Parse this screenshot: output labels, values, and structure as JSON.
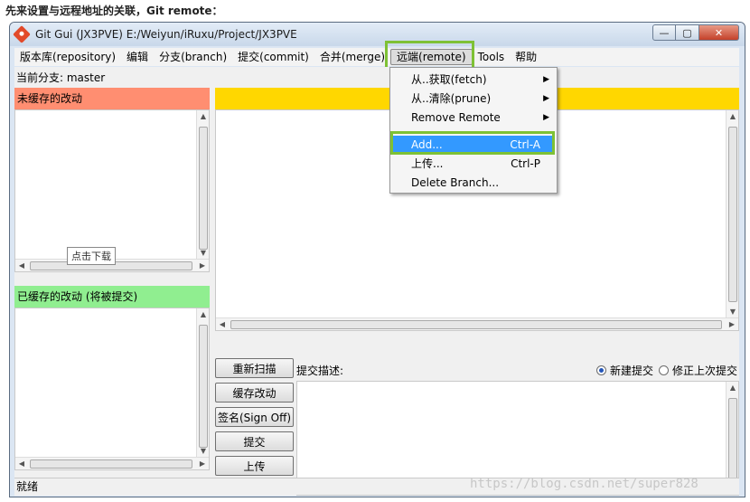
{
  "caption": "先来设置与远程地址的关联，Git remote：",
  "window": {
    "title": "Git Gui (JX3PVE) E:/Weiyun/iRuxu/Project/JX3PVE",
    "min_label": "—",
    "max_label": "▢",
    "close_label": "✕"
  },
  "menubar": {
    "items": [
      "版本库(repository)",
      "编辑",
      "分支(branch)",
      "提交(commit)",
      "合并(merge)",
      "远端(remote)",
      "Tools",
      "帮助"
    ]
  },
  "branch_label": "当前分支: master",
  "panes": {
    "unstaged_title": "未缓存的改动",
    "staged_title": "已缓存的改动 (将被提交)"
  },
  "download_tip": "点击下载",
  "commit": {
    "label": "提交描述:",
    "radio_new": "新建提交",
    "radio_amend": "修正上次提交"
  },
  "buttons": {
    "rescan": "重新扫描",
    "stage": "缓存改动",
    "signoff": "签名(Sign Off)",
    "commit": "提交",
    "push": "上传"
  },
  "status": "就绪",
  "watermark": "https://blog.csdn.net/super828",
  "dropdown": {
    "fetch": "从..获取(fetch)",
    "prune": "从..清除(prune)",
    "remove_remote": "Remove Remote",
    "add": "Add...",
    "add_shortcut": "Ctrl-A",
    "push": "上传...",
    "push_shortcut": "Ctrl-P",
    "delete_branch": "Delete Branch..."
  },
  "colors": {
    "unstaged_header": "#ff8e71",
    "staged_header": "#90ee90",
    "diff_header": "#ffd700",
    "highlight_box": "#7ec135",
    "menu_hover": "#3399ff"
  }
}
